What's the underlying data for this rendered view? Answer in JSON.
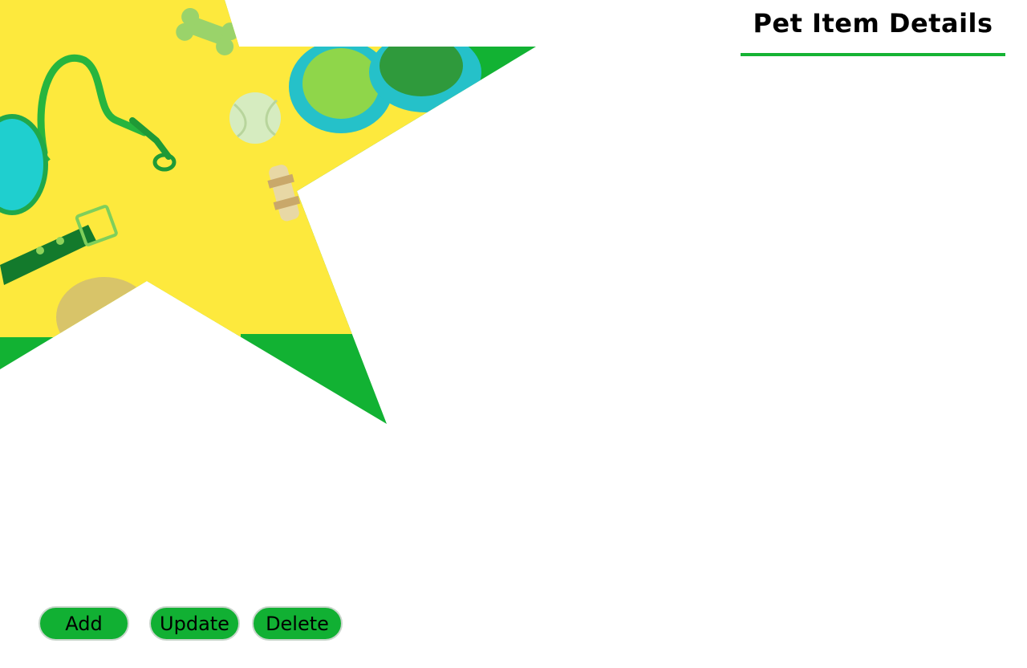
{
  "header": {
    "title": "Pet Item Details"
  },
  "hero": {
    "image_subject": "pet supplies: leash, collar, food bowls, tennis ball, chew bone, spiky ball on yellow background",
    "colors": {
      "accent_green": "#12b233",
      "background_yellow": "#ffe93d",
      "bowl_teal": "#1fc9c9"
    }
  },
  "actions": {
    "add_label": "Add",
    "update_label": "Update",
    "delete_label": "Delete"
  },
  "colors": {
    "button_green": "#11b033",
    "underline_green": "#15b334"
  }
}
